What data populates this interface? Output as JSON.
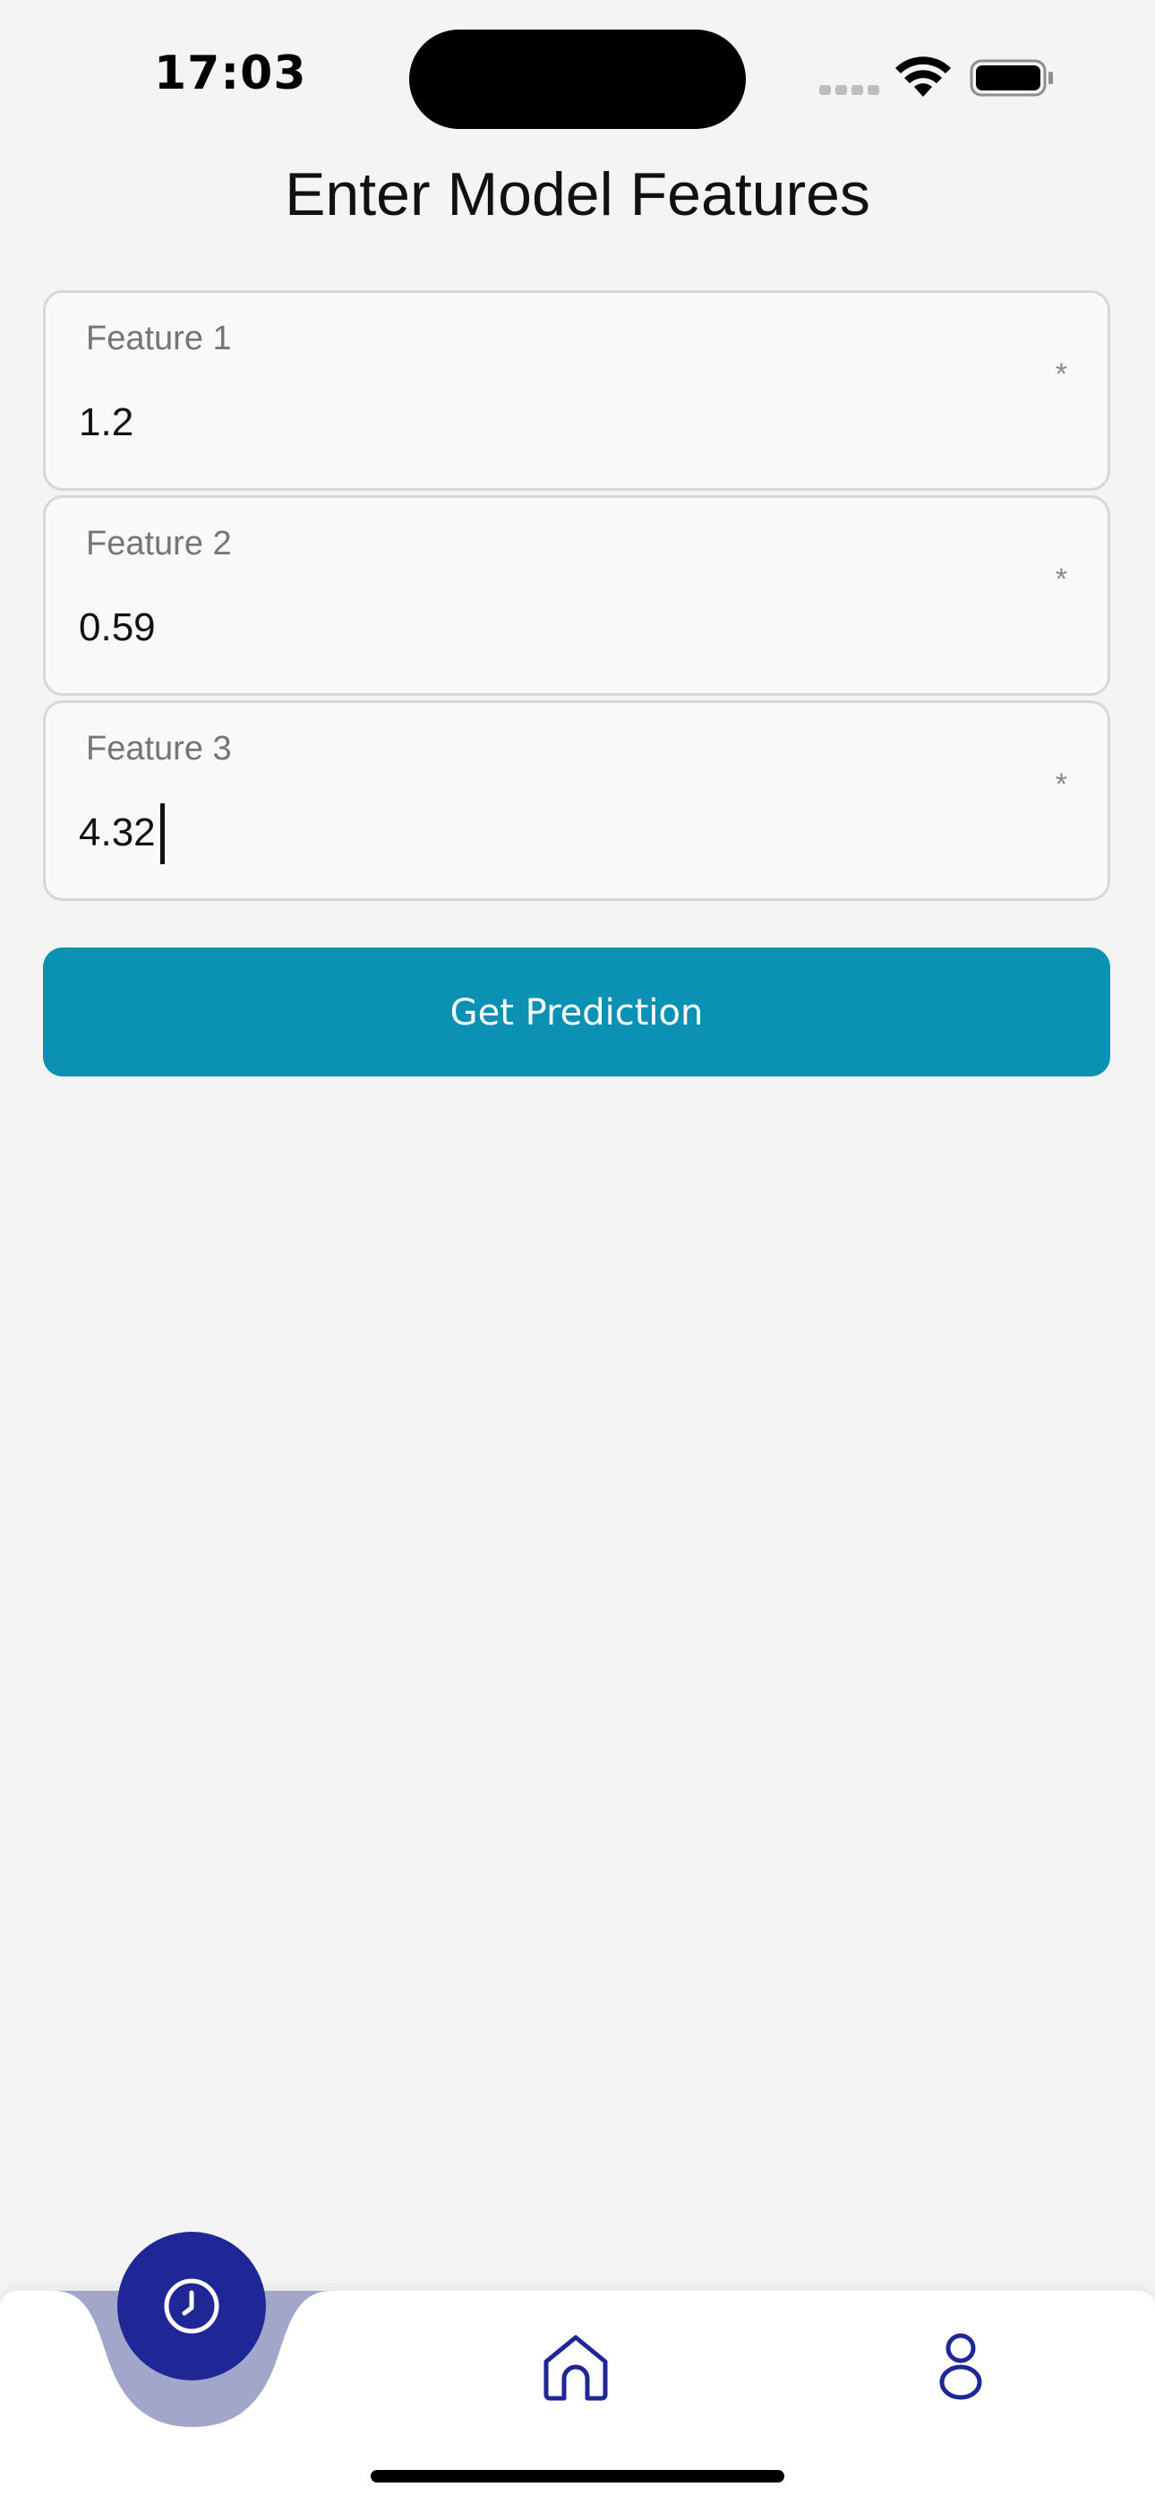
{
  "status_bar": {
    "time": "17:03"
  },
  "header": {
    "title": "Enter Model Features"
  },
  "form": {
    "fields": [
      {
        "label": "Feature 1",
        "value": "1.2",
        "required_mark": "*"
      },
      {
        "label": "Feature 2",
        "value": "0.59",
        "required_mark": "*"
      },
      {
        "label": "Feature 3",
        "value": "4.32",
        "required_mark": "*"
      }
    ],
    "submit_label": "Get Prediction"
  },
  "tab_bar": {
    "items": [
      {
        "icon": "clock-icon",
        "active": true
      },
      {
        "icon": "home-icon",
        "active": false
      },
      {
        "icon": "user-icon",
        "active": false
      }
    ]
  },
  "colors": {
    "accent": "#0a91b4",
    "tab_active": "#1f2797",
    "tab_notch": "#a2a6c9",
    "background": "#f4f4f4"
  }
}
